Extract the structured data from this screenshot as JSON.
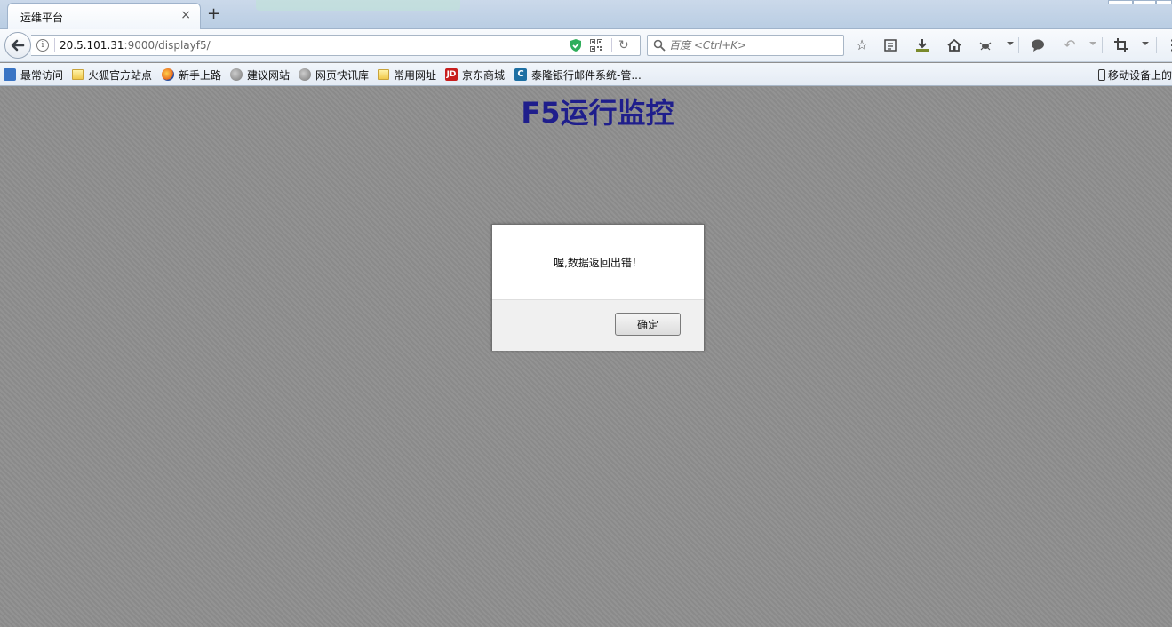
{
  "browser": {
    "tab": {
      "title": "运维平台",
      "close": "×"
    },
    "new_tab": "+",
    "url": {
      "host": "20.5.101.31",
      "rest": ":9000/displayf5/"
    },
    "search": {
      "placeholder": "百度 <Ctrl+K>"
    },
    "bookmarks": [
      {
        "label": "最常访问",
        "icon": "most-visited-icon"
      },
      {
        "label": "火狐官方站点",
        "icon": "folder-icon"
      },
      {
        "label": "新手上路",
        "icon": "firefox-icon"
      },
      {
        "label": "建议网站",
        "icon": "globe-icon"
      },
      {
        "label": "网页快讯库",
        "icon": "globe-icon"
      },
      {
        "label": "常用网址",
        "icon": "folder-icon"
      },
      {
        "label": "京东商城",
        "icon": "jd-icon"
      },
      {
        "label": "泰隆银行邮件系统-管...",
        "icon": "mail-c-icon"
      }
    ],
    "mobile_bookmarks": "移动设备上的",
    "icons": {
      "jd": "JD",
      "c": "C"
    }
  },
  "page": {
    "title": "F5运行监控",
    "dialog": {
      "message": "喔,数据返回出错！",
      "ok_label": "确定"
    }
  }
}
